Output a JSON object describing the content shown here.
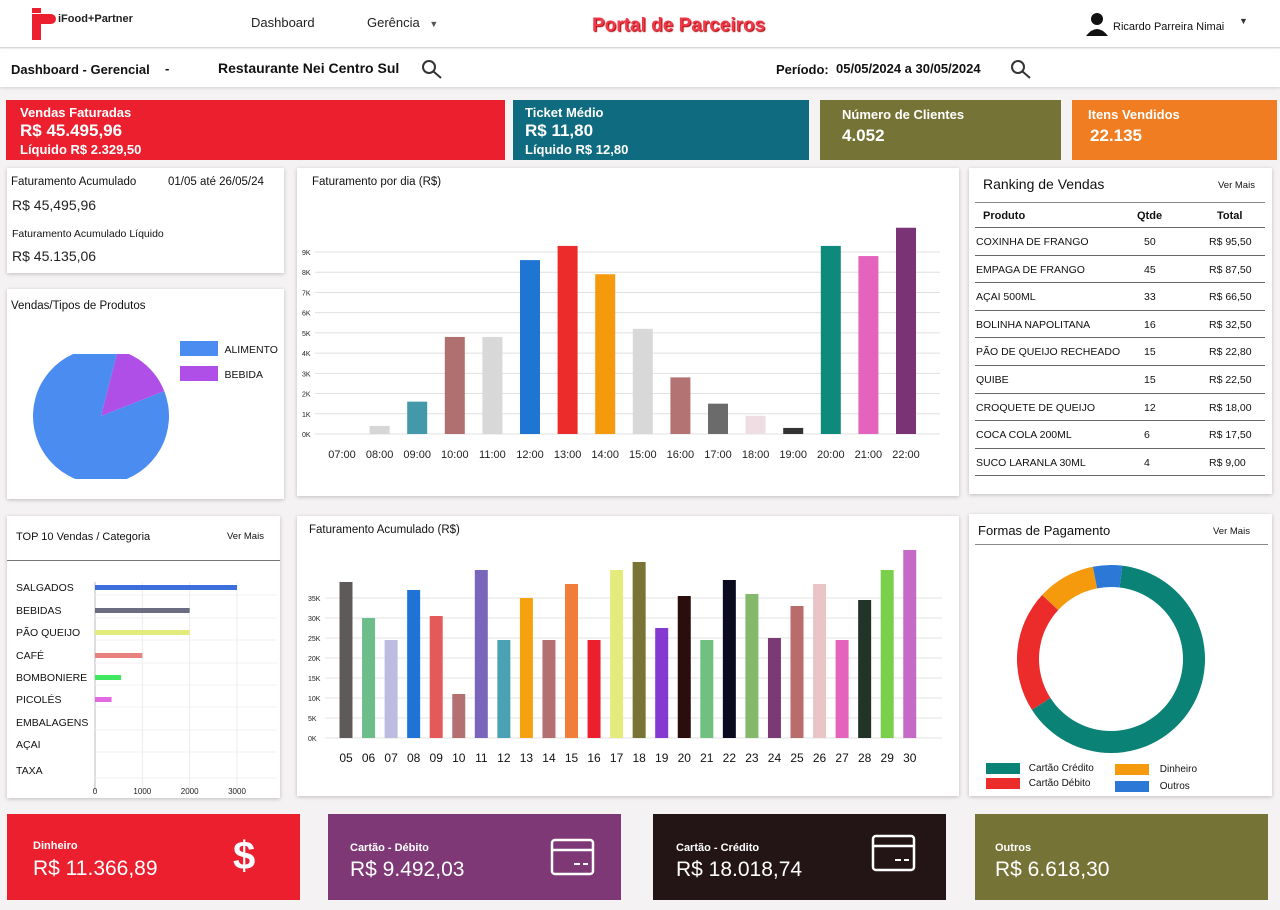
{
  "header": {
    "logo_text": "iFood+Partner",
    "nav": {
      "dashboard": "Dashboard",
      "gerencia": "Gerência"
    },
    "portal_title": "Portal de Parceiros",
    "user_name": "Ricardo Parreira Nimai"
  },
  "subbar": {
    "page_label": "Dashboard - Gerencial",
    "separator": "-",
    "restaurant": "Restaurante Nei Centro Sul",
    "period_label": "Período:",
    "period_value": "05/05/2024 a 30/05/2024"
  },
  "kpis": {
    "vendas": {
      "title": "Vendas Faturadas",
      "value": "R$ 45.495,96",
      "sub": "Líquido R$ 2.329,50",
      "color": "#ec1f2e"
    },
    "ticket": {
      "title": "Ticket Médio",
      "value": "R$ 11,80",
      "sub": "Líquido R$ 12,80",
      "color": "#0f6b80"
    },
    "clientes": {
      "title": "Número de Clientes",
      "value": "4.052",
      "color": "#757335"
    },
    "itens": {
      "title": "Itens Vendidos",
      "value": "22.135",
      "color": "#f07d22"
    }
  },
  "fat_acum_card": {
    "title": "Faturamento Acumulado",
    "range": "01/05 até 26/05/24",
    "value": "R$ 45,495,96",
    "liquido_title": "Faturamento Acumulado Líquido",
    "liquido_value": "R$ 45.135,06"
  },
  "pie_card": {
    "title": "Vendas/Tipos de Produtos",
    "legend": [
      {
        "label": "ALIMENTO",
        "color": "#4a8cf0",
        "value": 85
      },
      {
        "label": "BEBIDA",
        "color": "#b04fe8",
        "value": 15
      }
    ]
  },
  "chart_data": [
    {
      "type": "bar",
      "title": "Faturamento por dia (R$)",
      "categories": [
        "07:00",
        "08:00",
        "09:00",
        "10:00",
        "11:00",
        "12:00",
        "13:00",
        "14:00",
        "15:00",
        "16:00",
        "17:00",
        "18:00",
        "19:00",
        "20:00",
        "21:00",
        "22:00"
      ],
      "values": [
        0,
        400,
        1600,
        4800,
        4800,
        8600,
        9300,
        7900,
        5200,
        2800,
        1500,
        900,
        300,
        9300,
        8800,
        10200
      ],
      "colors": [
        "#cfcfcf",
        "#d6d6d6",
        "#4398aa",
        "#b07070",
        "#d8d8d8",
        "#1e76d2",
        "#ec2b2b",
        "#f59a0c",
        "#d8d8d8",
        "#b37373",
        "#6b6b6b",
        "#eedde3",
        "#333333",
        "#0d8a7c",
        "#e463bd",
        "#7a3476"
      ],
      "yticks": [
        "0K",
        "1K",
        "2K",
        "3K",
        "4K",
        "5K",
        "6K",
        "7K",
        "8K",
        "9K"
      ],
      "ylim": [
        0,
        9000
      ]
    },
    {
      "type": "bar",
      "title": "Faturamento Acumulado (R$)",
      "categories": [
        "05",
        "06",
        "07",
        "08",
        "09",
        "10",
        "11",
        "12",
        "13",
        "14",
        "15",
        "16",
        "17",
        "18",
        "19",
        "20",
        "21",
        "22",
        "23",
        "24",
        "25",
        "26",
        "27",
        "28",
        "29",
        "30"
      ],
      "values": [
        39000,
        30000,
        24500,
        37000,
        30500,
        11000,
        42000,
        24500,
        35000,
        24500,
        38500,
        24500,
        42000,
        44000,
        27500,
        35500,
        24500,
        39500,
        36000,
        25000,
        33000,
        38500,
        24500,
        34500,
        42000,
        47000
      ],
      "colors": [
        "#5f5a5a",
        "#6dbd8a",
        "#bdbbe0",
        "#1f73d6",
        "#e45a5a",
        "#b47070",
        "#7966bb",
        "#49a1b3",
        "#f5a20e",
        "#b47070",
        "#f07d3a",
        "#ec1f2e",
        "#e3eb7c",
        "#7a7336",
        "#8439d0",
        "#2a0e0e",
        "#70c080",
        "#0b0b1f",
        "#84b86b",
        "#7b3a73",
        "#b86c6c",
        "#eac5c8",
        "#e463bd",
        "#223328",
        "#7bd04b",
        "#c56ac7"
      ],
      "yticks": [
        "0K",
        "5K",
        "10K",
        "15K",
        "20K",
        "25K",
        "30K",
        "35K"
      ],
      "ylim": [
        0,
        35000
      ]
    },
    {
      "type": "bar",
      "title": "TOP 10 Vendas / Categoria",
      "categories": [
        "SALGADOS",
        "BEBIDAS",
        "PÃO QUEIJO",
        "CAFÉ",
        "BOMBONIERE",
        "PICOLÉS",
        "EMBALAGENS",
        "AÇAI",
        "TAXA"
      ],
      "values": [
        3000,
        2000,
        2000,
        1000,
        550,
        350,
        0,
        0,
        0
      ],
      "colors": [
        "#3d6fdc",
        "#6b6d82",
        "#e3eb7c",
        "#e88080",
        "#3fe860",
        "#e36ae0",
        "#999999",
        "#999999",
        "#999999"
      ],
      "xticks": [
        "0",
        "1000",
        "2000",
        "3000"
      ],
      "xlim": [
        0,
        3000
      ]
    },
    {
      "type": "pie",
      "title": "Formas de Pagamento",
      "labels": [
        "Cartão Crédito",
        "Cartão Débito",
        "Dinheiro",
        "Outros"
      ],
      "values": [
        64,
        21,
        10,
        5
      ],
      "colors": [
        "#0a8276",
        "#ec2b2b",
        "#f59a0c",
        "#2b78d6"
      ]
    }
  ],
  "ranking": {
    "title": "Ranking de Vendas",
    "ver_mais": "Ver Mais",
    "headers": [
      "Produto",
      "Qtde",
      "Total"
    ],
    "rows": [
      [
        "COXINHA DE FRANGO",
        "50",
        "R$ 95,50"
      ],
      [
        "EMPAGA DE FRANGO",
        "45",
        "R$ 87,50"
      ],
      [
        "AÇAI 500ML",
        "33",
        "R$ 66,50"
      ],
      [
        "BOLINHA NAPOLITANA",
        "16",
        "R$ 32,50"
      ],
      [
        "PÃO DE QUEIJO RECHEADO",
        "15",
        "R$ 22,80"
      ],
      [
        "QUIBE",
        "15",
        "R$ 22,50"
      ],
      [
        "CROQUETE DE QUEIJO",
        "12",
        "R$ 18,00"
      ],
      [
        "COCA COLA 200ML",
        "6",
        "R$ 17,50"
      ],
      [
        "SUCO LARANLA 30ML",
        "4",
        "R$ 9,00"
      ]
    ]
  },
  "top10": {
    "ver_mais": "Ver Mais"
  },
  "pagamento": {
    "ver_mais": "Ver Mais"
  },
  "bottom": {
    "dinheiro": {
      "label": "Dinheiro",
      "value": "R$ 11.366,89",
      "color": "#ec1f2e"
    },
    "debito": {
      "label": "Cartão - Débito",
      "value": "R$ 9.492,03",
      "color": "#7f3876"
    },
    "credito": {
      "label": "Cartão - Crédito",
      "value": "R$ 18.018,74",
      "color": "#231516"
    },
    "outros": {
      "label": "Outros",
      "value": "R$ 6.618,30",
      "color": "#757335"
    }
  }
}
